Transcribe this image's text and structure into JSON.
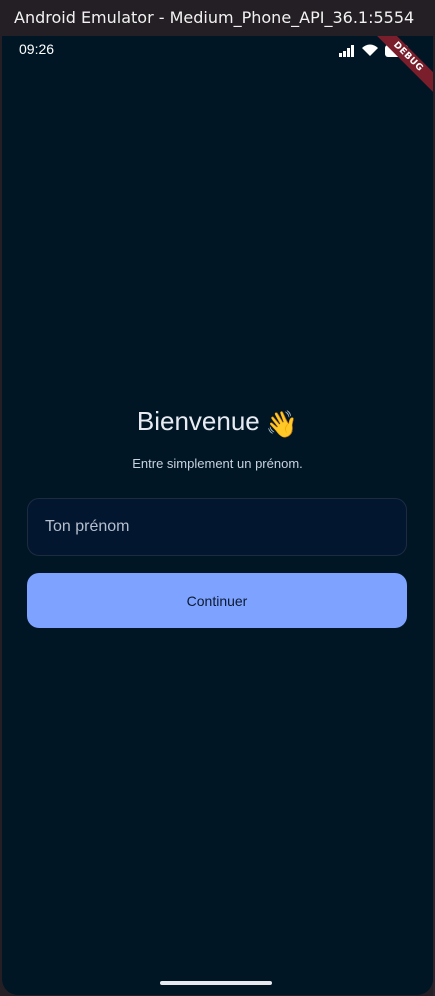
{
  "window": {
    "title": "Android Emulator - Medium_Phone_API_36.1:5554"
  },
  "statusbar": {
    "time": "09:26",
    "icons": [
      "signal-icon",
      "wifi-icon",
      "battery-icon"
    ],
    "debug_banner": "DEBUG"
  },
  "welcome": {
    "title": "Bienvenue",
    "emoji": "👋",
    "subtitle": "Entre simplement un prénom."
  },
  "form": {
    "name_placeholder": "Ton prénom",
    "name_value": "",
    "continue_label": "Continuer"
  },
  "colors": {
    "background": "#001624",
    "accent": "#7da2ff",
    "input_background": "#021630",
    "ribbon": "#7a1e2c"
  }
}
